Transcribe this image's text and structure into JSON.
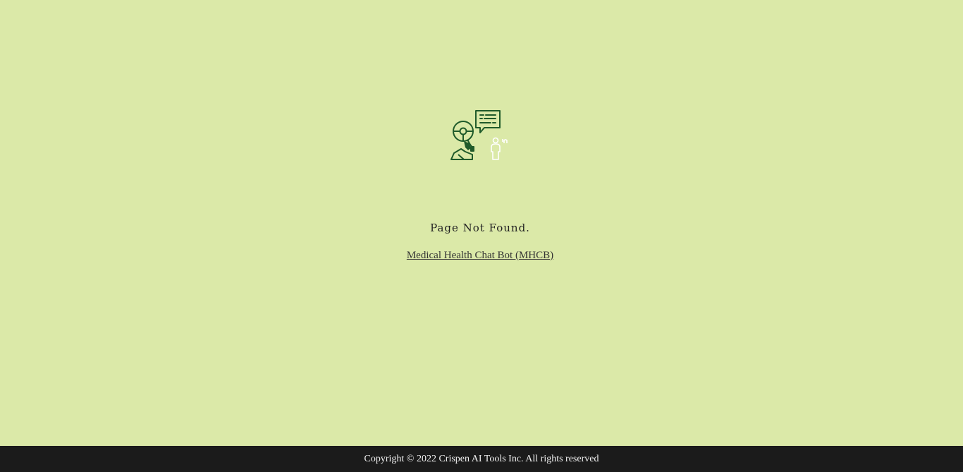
{
  "page": {
    "title": "Page Not Found.",
    "link_text": "Medical Health Chat Bot (MHCB)",
    "illustration_icon": "robot-doctor-chat-icon"
  },
  "footer": {
    "copyright": "Copyright © 2022 Crispen AI Tools Inc. All rights reserved"
  },
  "colors": {
    "background": "#dbe9a8",
    "icon_primary": "#1f5a2a",
    "icon_secondary": "#ffffff",
    "footer_bg": "#1b1b1b"
  }
}
